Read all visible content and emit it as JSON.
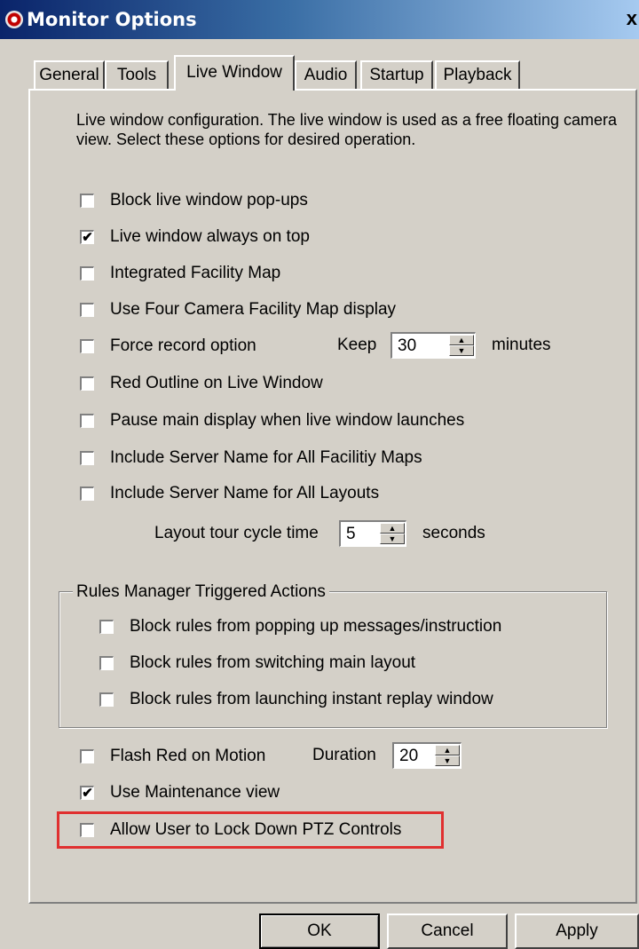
{
  "window": {
    "title": "Monitor Options",
    "close_glyph": "x"
  },
  "tabs": [
    {
      "label": "General",
      "active": false
    },
    {
      "label": "Tools",
      "active": false
    },
    {
      "label": "Live Window",
      "active": true
    },
    {
      "label": "Audio",
      "active": false
    },
    {
      "label": "Startup",
      "active": false
    },
    {
      "label": "Playback",
      "active": false
    }
  ],
  "description": "Live window configuration.  The live window is used as a free floating camera view.  Select these options for desired operation.",
  "options": [
    {
      "label": "Block live window pop-ups",
      "checked": false
    },
    {
      "label": "Live window always on top",
      "checked": true
    },
    {
      "label": "Integrated Facility Map",
      "checked": false
    },
    {
      "label": "Use Four Camera Facility Map display",
      "checked": false
    },
    {
      "label": "Force record option",
      "checked": false
    },
    {
      "label": "Red Outline on Live Window",
      "checked": false
    },
    {
      "label": "Pause main display when live window launches",
      "checked": false
    },
    {
      "label": "Include Server Name for All Facilitiy Maps",
      "checked": false
    },
    {
      "label": "Include Server Name for All Layouts",
      "checked": false
    }
  ],
  "keep": {
    "label": "Keep",
    "value": "30",
    "unit": "minutes"
  },
  "layout_tour": {
    "label": "Layout tour cycle time",
    "value": "5",
    "unit": "seconds"
  },
  "rules_group": {
    "title": "Rules Manager Triggered Actions",
    "options": [
      {
        "label": "Block rules from popping up messages/instruction",
        "checked": false
      },
      {
        "label": "Block rules from switching main layout",
        "checked": false
      },
      {
        "label": "Block rules from launching instant replay window",
        "checked": false
      }
    ]
  },
  "bottom_options": [
    {
      "label": "Flash Red on Motion",
      "checked": false
    },
    {
      "label": "Use Maintenance view",
      "checked": true
    },
    {
      "label": "Allow User to Lock Down PTZ Controls",
      "checked": false
    }
  ],
  "duration": {
    "label": "Duration",
    "value": "20"
  },
  "buttons": {
    "ok": "OK",
    "cancel": "Cancel",
    "apply": "Apply"
  },
  "check_glyph": "✔",
  "colors": {
    "title_bar": "#0a246a",
    "dialog_bg": "#d4d0c8",
    "highlight_border": "#e03030"
  }
}
